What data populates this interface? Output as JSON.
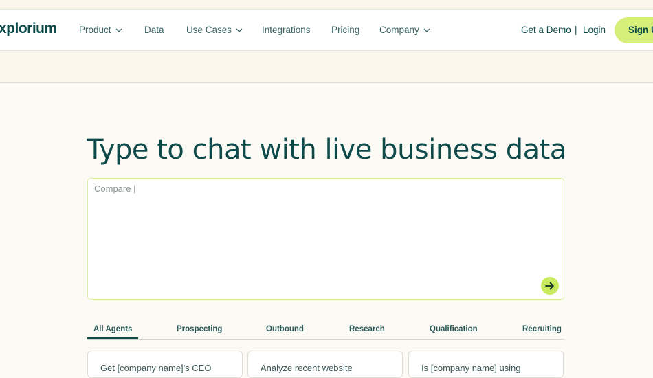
{
  "header": {
    "logo": "xplorium",
    "nav": [
      {
        "label": "Product"
      },
      {
        "label": "Data"
      },
      {
        "label": "Use Cases"
      },
      {
        "label": "Integrations"
      },
      {
        "label": "Pricing"
      },
      {
        "label": "Company"
      }
    ],
    "get_demo": "Get a Demo",
    "separator": "|",
    "login": "Login",
    "signup": "Sign Up"
  },
  "hero": {
    "title": "Type to chat with live business data"
  },
  "chat": {
    "placeholder": "Compare |",
    "send_icon": "arrow-right-icon",
    "accent": "#c9ea5e"
  },
  "tabs": [
    "All Agents",
    "Prospecting",
    "Outbound",
    "Research",
    "Qualification",
    "Recruiting"
  ],
  "cards": [
    {
      "text": "Get [company name]'s CEO"
    },
    {
      "text": "Analyze recent website"
    },
    {
      "text": "Is [company name] using"
    }
  ],
  "colors": {
    "brand": "#0e4a4a",
    "accent": "#d6ef7a",
    "background": "#fcfaf4"
  }
}
